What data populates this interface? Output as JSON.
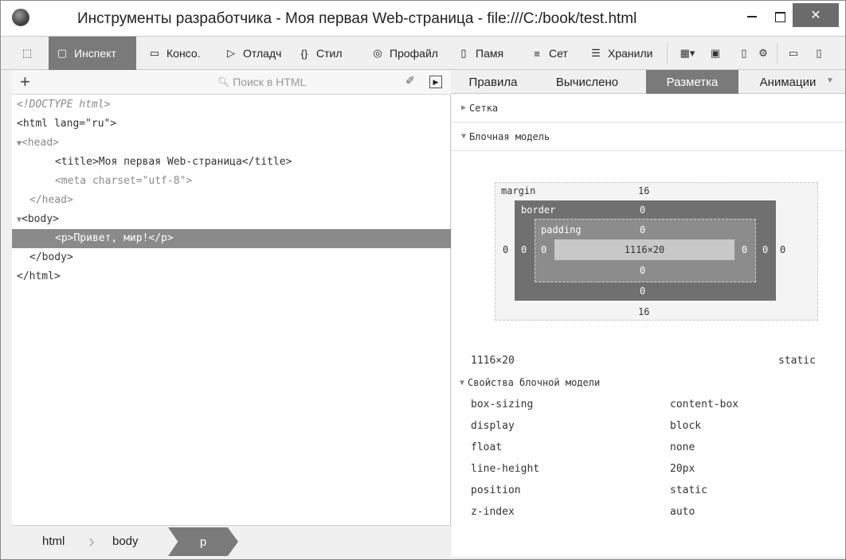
{
  "window": {
    "title": "Инструменты разработчика - Моя первая Web-страница - file:///C:/book/test.html",
    "close_glyph": "✕"
  },
  "toolbar": {
    "tabs": [
      {
        "label": "Инспект",
        "icon": "inspector-icon"
      },
      {
        "label": "Консо.",
        "icon": "console-icon"
      },
      {
        "label": "Отладч",
        "icon": "debugger-icon"
      },
      {
        "label": "Стил",
        "icon": "style-editor-icon"
      },
      {
        "label": "Профайл",
        "icon": "profiler-icon"
      },
      {
        "label": "Памя",
        "icon": "memory-icon"
      },
      {
        "label": "Сет",
        "icon": "network-icon"
      },
      {
        "label": "Хранили",
        "icon": "storage-icon"
      }
    ],
    "active_tab": "Инспект"
  },
  "inspector": {
    "search_placeholder": "Поиск в HTML",
    "html_lines": [
      "<!DOCTYPE html>",
      "<html lang=\"ru\">",
      "<head>",
      "<title>Моя первая Web-страница</title>",
      "<meta charset=\"utf-8\">",
      "</head>",
      "<body>",
      "<p>Привет, мир!</p>",
      "</body>",
      "</html>"
    ]
  },
  "breadcrumbs": [
    "html",
    "body",
    "p"
  ],
  "right_tabs": [
    "Правила",
    "Вычислено",
    "Разметка",
    "Анимации"
  ],
  "active_right_tab": "Разметка",
  "sections": {
    "grid": "Сетка",
    "box_model": "Блочная модель",
    "box_props": "Свойства блочной модели"
  },
  "box_model": {
    "margin_label": "margin",
    "border_label": "border",
    "padding_label": "padding",
    "margin_top": "16",
    "margin_bottom": "16",
    "margin_left": "0",
    "margin_right": "0",
    "border_top": "0",
    "border_bottom": "0",
    "border_left": "0",
    "border_right": "0",
    "padding_top": "0",
    "padding_bottom": "0",
    "padding_left": "0",
    "padding_right": "0",
    "content": "1116×20",
    "size_summary": "1116×20",
    "position": "static"
  },
  "properties": [
    {
      "name": "box-sizing",
      "value": "content-box"
    },
    {
      "name": "display",
      "value": "block"
    },
    {
      "name": "float",
      "value": "none"
    },
    {
      "name": "line-height",
      "value": "20px"
    },
    {
      "name": "position",
      "value": "static"
    },
    {
      "name": "z-index",
      "value": "auto"
    }
  ]
}
